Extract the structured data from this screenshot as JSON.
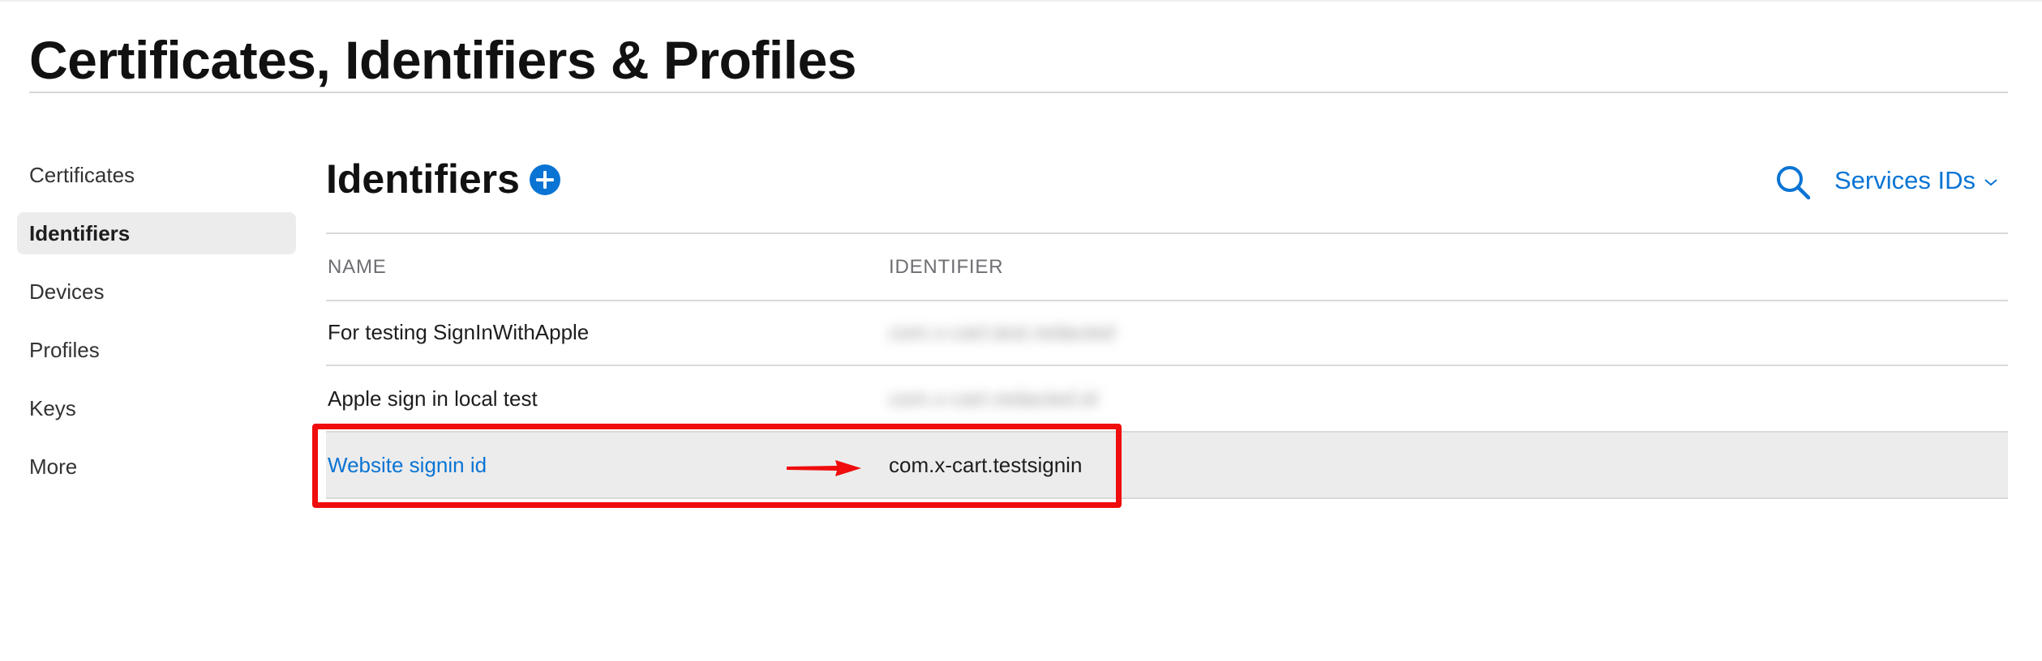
{
  "page": {
    "title": "Certificates, Identifiers & Profiles"
  },
  "sidebar": {
    "items": [
      {
        "label": "Certificates",
        "active": false
      },
      {
        "label": "Identifiers",
        "active": true
      },
      {
        "label": "Devices",
        "active": false
      },
      {
        "label": "Profiles",
        "active": false
      },
      {
        "label": "Keys",
        "active": false
      },
      {
        "label": "More",
        "active": false
      }
    ]
  },
  "main": {
    "section_title": "Identifiers",
    "add_icon": "plus-circle-icon",
    "search_icon": "search-icon",
    "filter": {
      "selected": "Services IDs",
      "icon": "chevron-down-icon"
    },
    "table": {
      "columns": [
        "NAME",
        "IDENTIFIER"
      ],
      "rows": [
        {
          "name": "For testing SignInWithApple",
          "identifier": "com.x-cart.test.redacted",
          "identifier_redacted": true,
          "selected": false
        },
        {
          "name": "Apple sign in local test",
          "identifier": "com.x-cart.redacted.id",
          "identifier_redacted": true,
          "selected": false
        },
        {
          "name": "Website signin id",
          "identifier": "com.x-cart.testsignin",
          "identifier_redacted": false,
          "selected": true
        }
      ]
    }
  },
  "annotation": {
    "color": "#f00d0d",
    "arrow_icon": "arrow-right-icon"
  },
  "colors": {
    "accent": "#0a74d4",
    "selected_row": "#ececec",
    "annotation": "#f00d0d"
  }
}
